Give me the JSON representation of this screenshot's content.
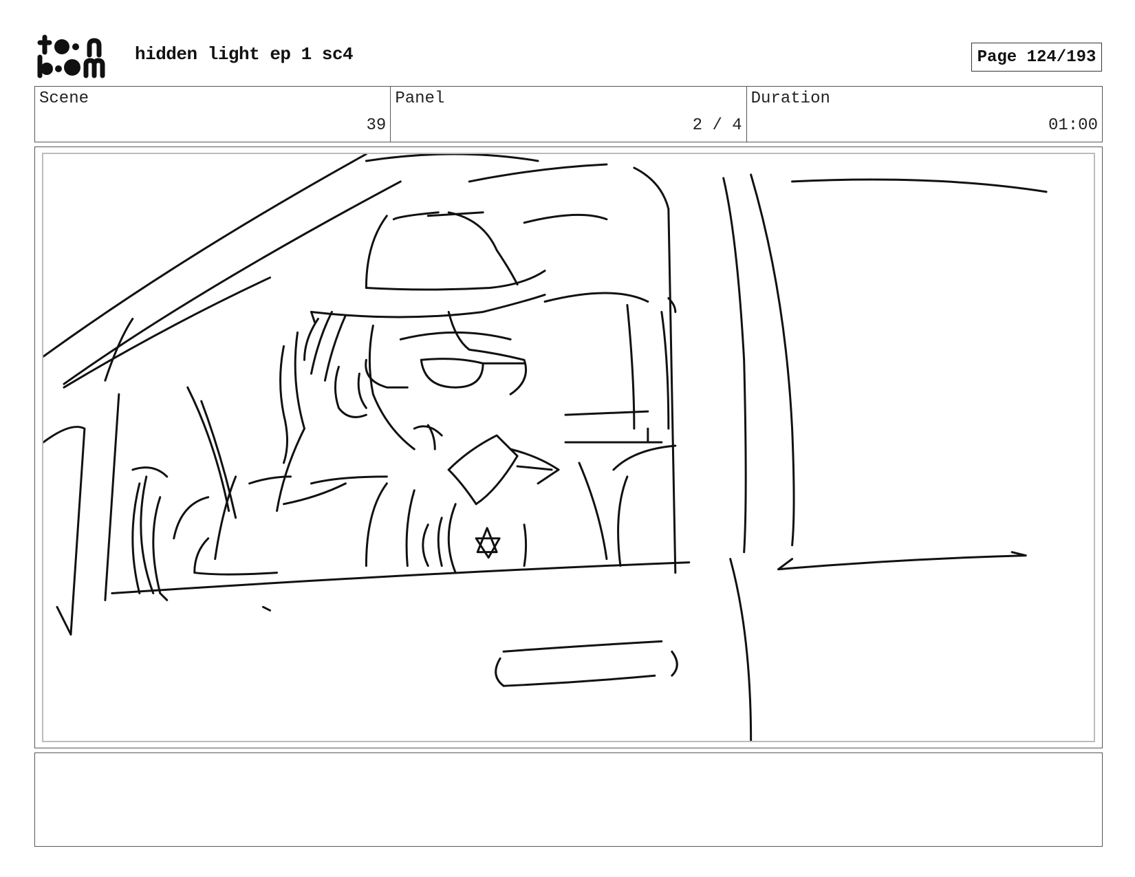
{
  "header": {
    "logo_text": "toon boom",
    "title": "hidden light ep 1 sc4",
    "page_label": "Page 124/193"
  },
  "info": {
    "scene_label": "Scene",
    "scene_value": "39",
    "panel_label": "Panel",
    "panel_value": "2 / 4",
    "duration_label": "Duration",
    "duration_value": "01:00"
  },
  "notes": {
    "text": ""
  }
}
